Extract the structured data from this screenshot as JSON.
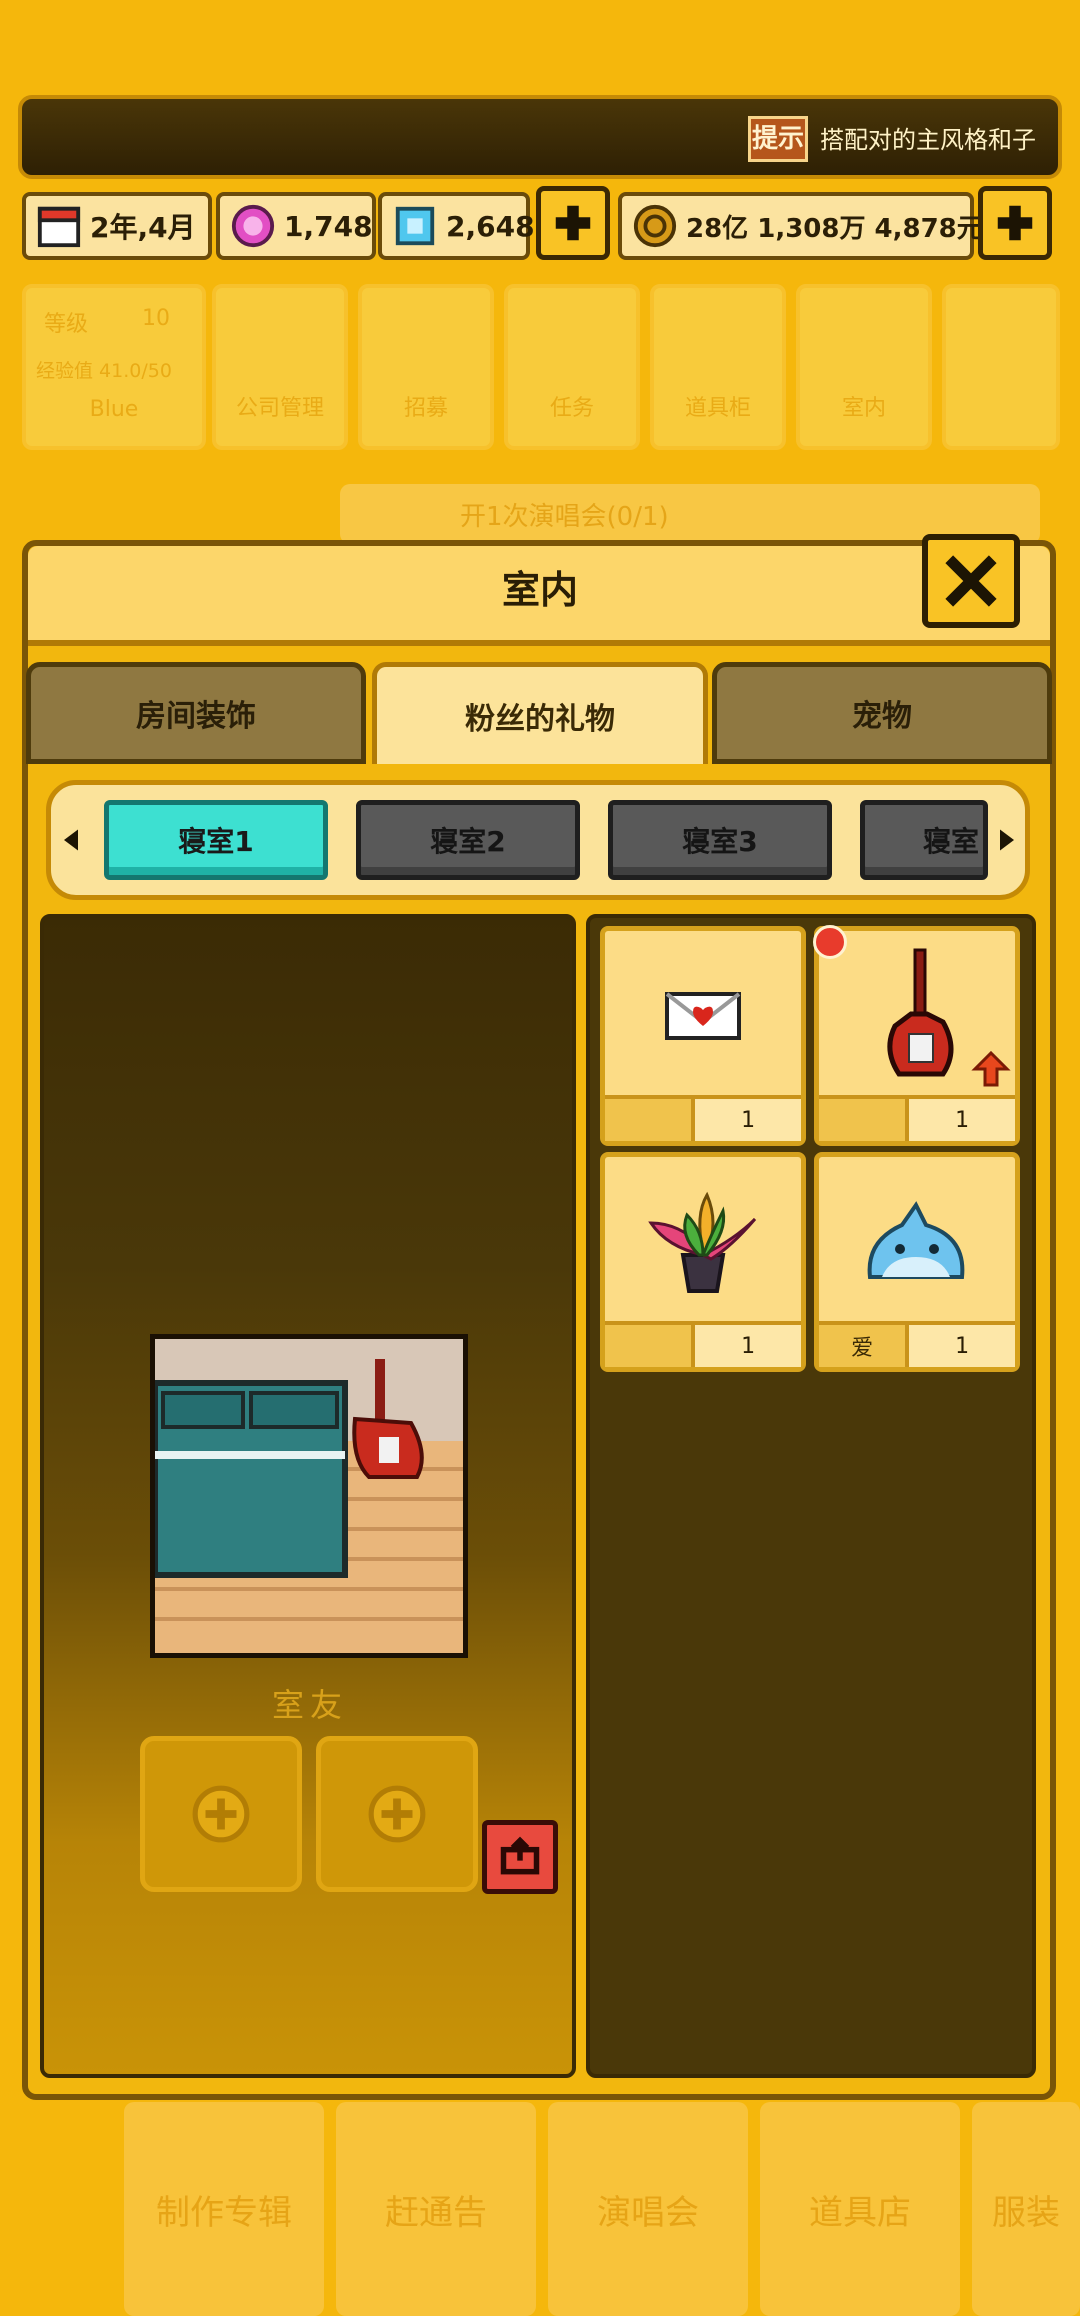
{
  "hint": {
    "icon_label": "提示",
    "text": "搭配对的主风格和子"
  },
  "currency": {
    "date": "2年,4月",
    "pink_gems": "1,748",
    "blue_gems": "2,648",
    "money": "28亿 1,308万 4,878元"
  },
  "background_menu": {
    "level_label": "等级",
    "level_value": "10",
    "exp_text": "经验值 41.0/50",
    "player_name": "Blue",
    "tiles": [
      "公司管理",
      "招募",
      "任务",
      "道具柜",
      "室内"
    ],
    "notice": "开1次演唱会(0/1)",
    "bottom": [
      "制作专辑",
      "赶通告",
      "演唱会",
      "道具店",
      "服装"
    ]
  },
  "dialog": {
    "title": "室内",
    "tabs": [
      "房间装饰",
      "粉丝的礼物",
      "宠物"
    ],
    "active_tab": 1,
    "rooms": [
      "寝室1",
      "寝室2",
      "寝室3",
      "寝室"
    ],
    "selected_room": 0,
    "roommate_label": "室友"
  },
  "gifts": [
    {
      "name": "letter",
      "left_label": "",
      "count": "1",
      "is_new": false,
      "upgradable": false
    },
    {
      "name": "guitar",
      "left_label": "",
      "count": "1",
      "is_new": true,
      "upgradable": true
    },
    {
      "name": "flower-pot",
      "left_label": "",
      "count": "1",
      "is_new": false,
      "upgradable": false
    },
    {
      "name": "shark-slime",
      "left_label": "爱",
      "count": "1",
      "is_new": false,
      "upgradable": false
    }
  ],
  "colors": {
    "accent": "#f5b70c",
    "selected_tab": "#3de0d1",
    "dark_panel": "#4a3809"
  }
}
